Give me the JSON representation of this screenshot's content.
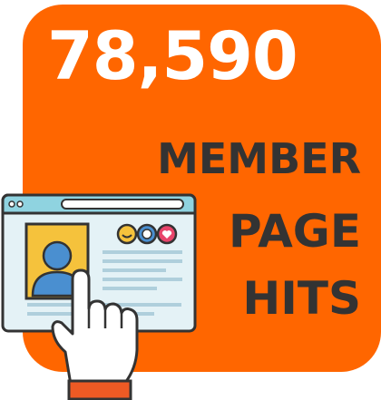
{
  "headline": {
    "value": "78,590",
    "label_line1": "MEMBER",
    "label_line2": "PAGE",
    "label_line3": "HITS"
  },
  "colors": {
    "card": "#FF6600",
    "headline_text": "#FFFFFF",
    "label_text": "#333333",
    "browser_frame": "#8FD3E0",
    "browser_body": "#E4F2F6",
    "profile_card": "#F5C23C",
    "avatar": "#4A8FD0",
    "hand": "#FFFFFF",
    "cuff": "#EE5A24"
  },
  "icons": [
    "browser-window-icon",
    "profile-photo-icon",
    "pointing-hand-icon",
    "smile-emoji-icon",
    "face-emoji-icon",
    "heart-emoji-icon"
  ]
}
